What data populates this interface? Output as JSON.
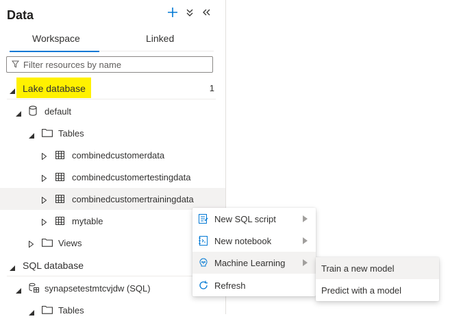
{
  "panel": {
    "title": "Data",
    "icons": {
      "add": "plus-icon",
      "collapse": "double-chevron-down-icon",
      "close": "double-chevron-left-icon"
    },
    "tabs": [
      {
        "label": "Workspace",
        "active": true
      },
      {
        "label": "Linked",
        "active": false
      }
    ],
    "filter": {
      "placeholder": "Filter resources by name",
      "value": ""
    }
  },
  "tree": {
    "lake_database": {
      "label": "Lake database",
      "count": "1"
    },
    "default_db": {
      "label": "default"
    },
    "tables_folder": {
      "label": "Tables"
    },
    "tables": [
      {
        "label": "combinedcustomerdata"
      },
      {
        "label": "combinedcustomertestingdata"
      },
      {
        "label": "combinedcustomertrainingdata"
      },
      {
        "label": "mytable"
      }
    ],
    "views_folder": {
      "label": "Views"
    },
    "sql_database": {
      "label": "SQL database"
    },
    "sql_pool": {
      "label": "synapsetestmtcvjdw (SQL)"
    },
    "sql_tables_folder": {
      "label": "Tables"
    }
  },
  "context_menu": {
    "items": [
      {
        "label": "New SQL script",
        "icon": "sql-script-icon",
        "has_submenu": true
      },
      {
        "label": "New notebook",
        "icon": "notebook-icon",
        "has_submenu": true
      },
      {
        "label": "Machine Learning",
        "icon": "machine-learning-icon",
        "has_submenu": true
      },
      {
        "label": "Refresh",
        "icon": "refresh-icon",
        "has_submenu": false
      }
    ]
  },
  "submenu": {
    "items": [
      {
        "label": "Train a new model"
      },
      {
        "label": "Predict with a model"
      }
    ]
  },
  "colors": {
    "accent": "#0078d4",
    "highlight": "#fff100",
    "hover": "#f3f2f1"
  }
}
